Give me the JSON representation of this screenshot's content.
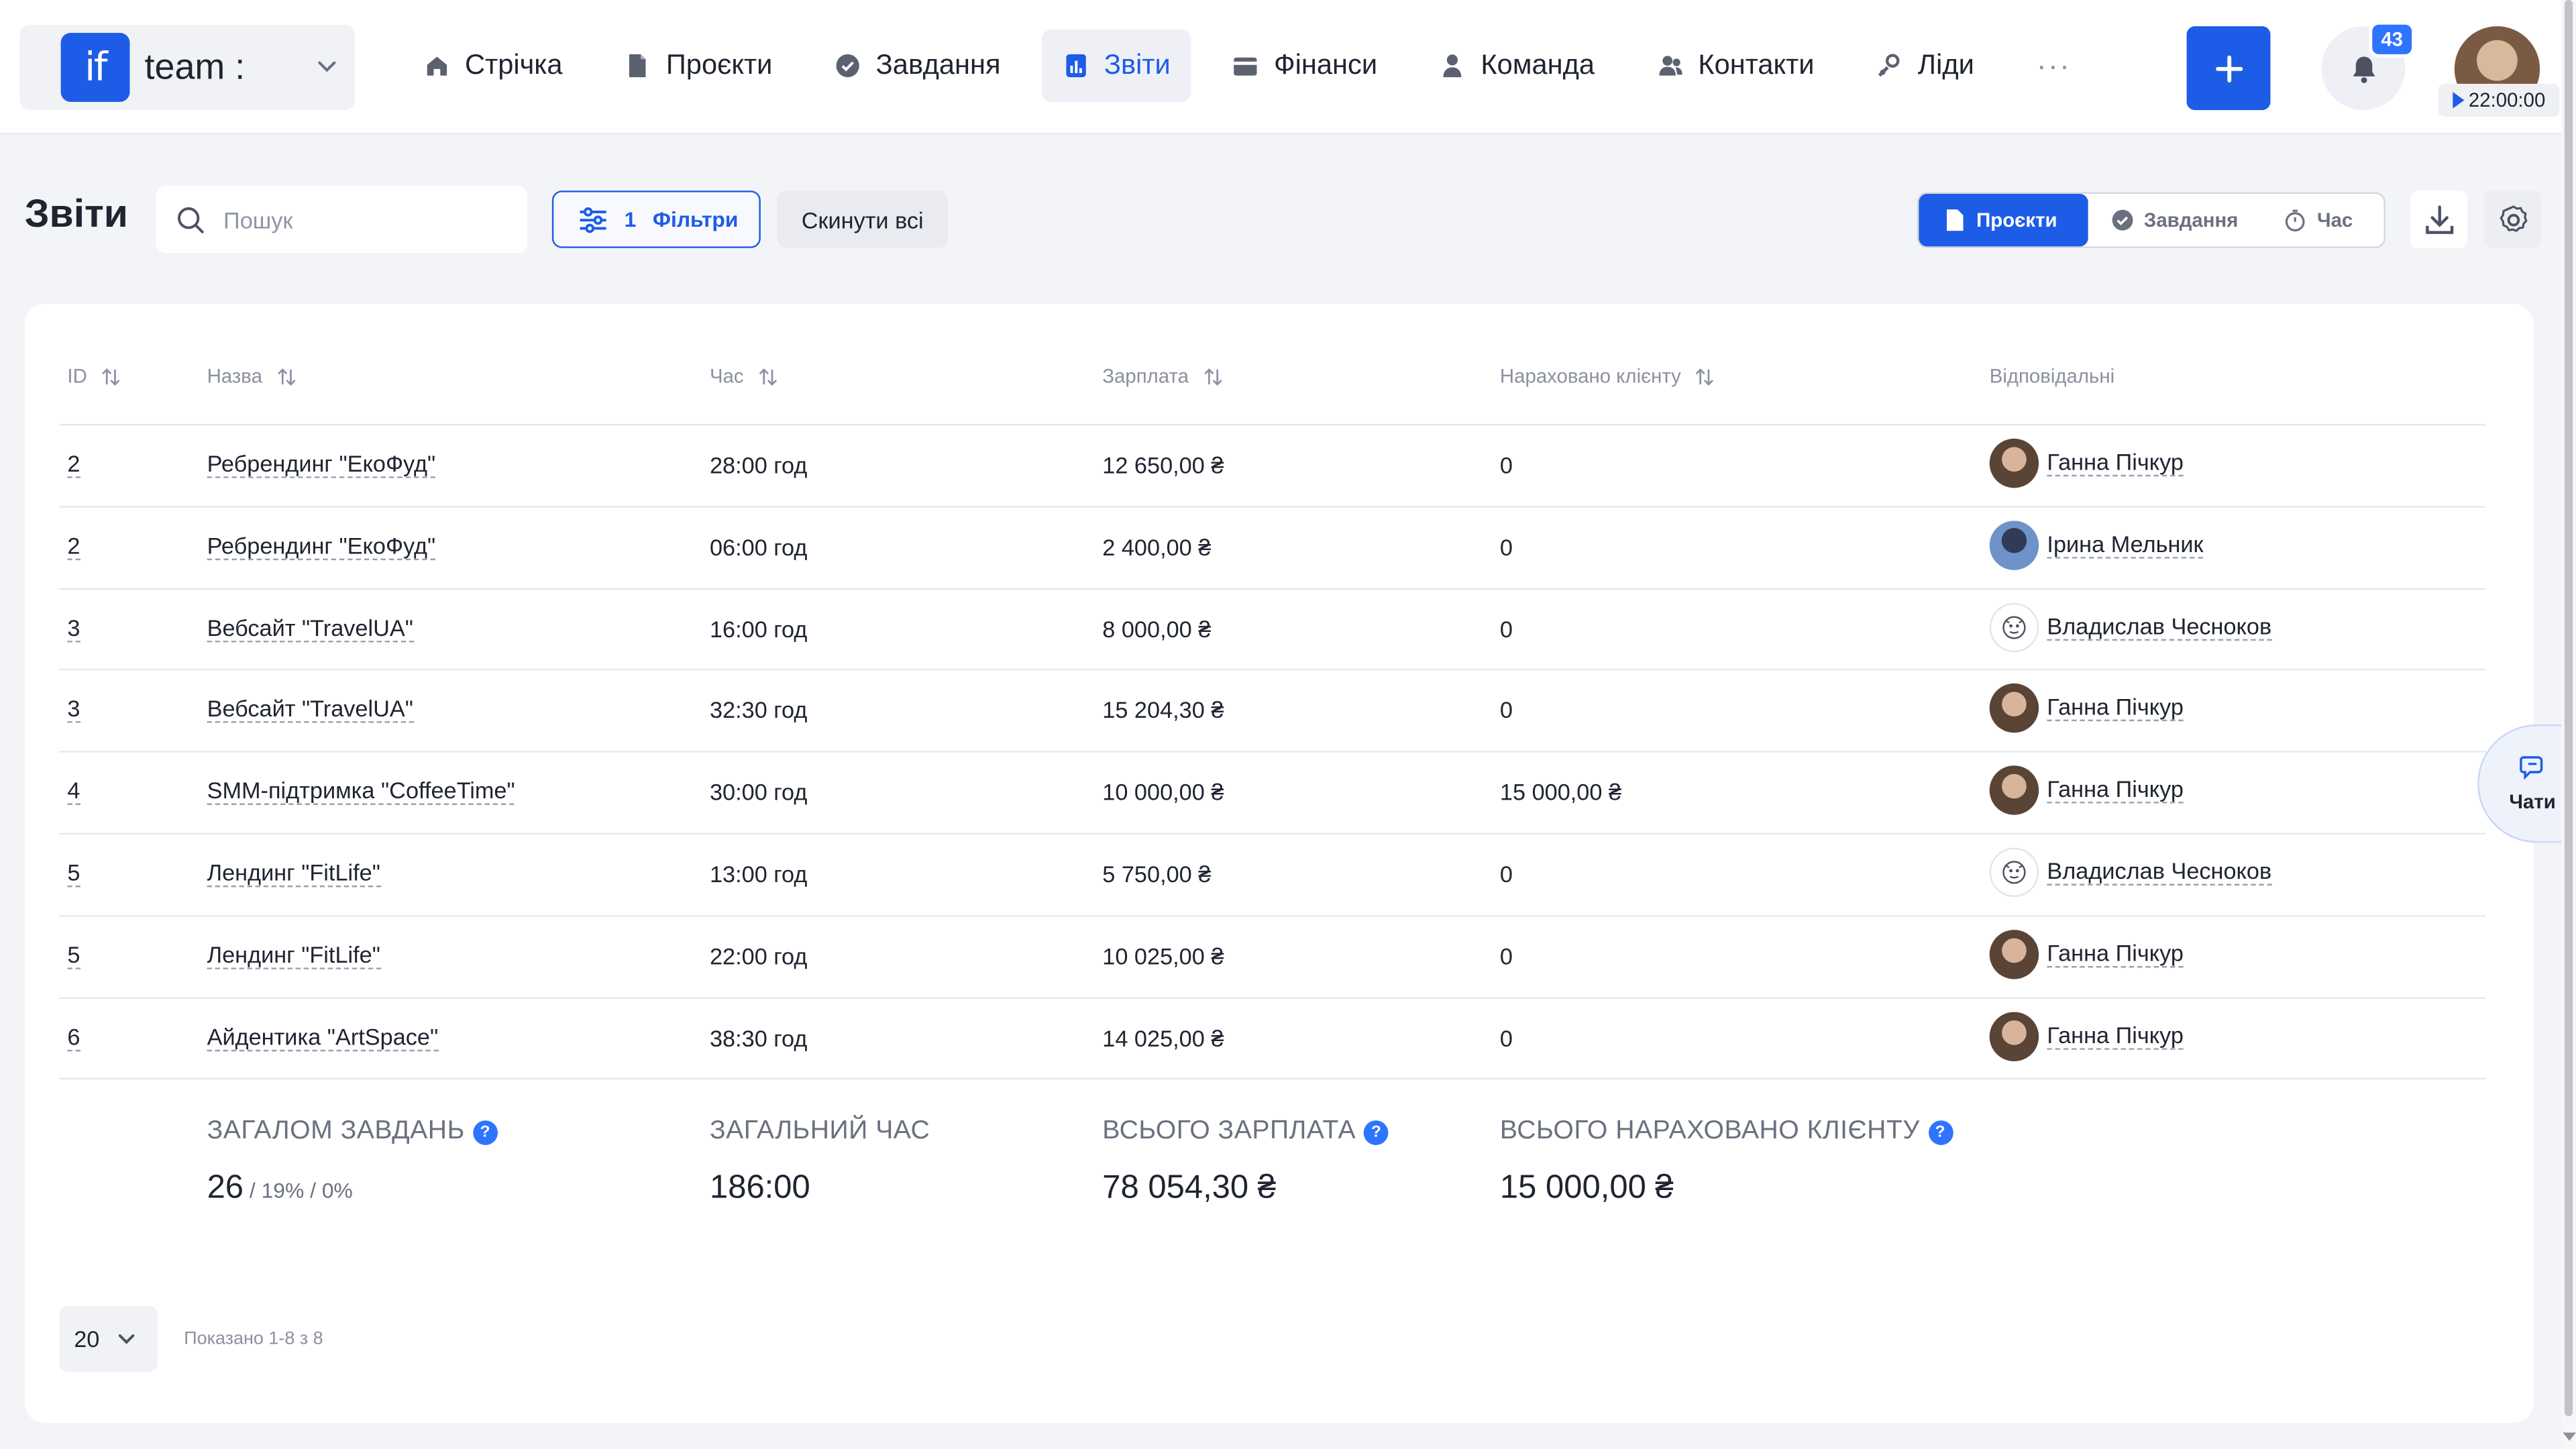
{
  "brand": {
    "logo_text": "if",
    "name": "team :"
  },
  "nav": {
    "items": [
      {
        "label": "Стрічка",
        "icon": "home-icon"
      },
      {
        "label": "Проєкти",
        "icon": "document-icon"
      },
      {
        "label": "Завдання",
        "icon": "check-circle-icon"
      },
      {
        "label": "Звіти",
        "icon": "chart-icon",
        "active": true
      },
      {
        "label": "Фінанси",
        "icon": "wallet-icon"
      },
      {
        "label": "Команда",
        "icon": "person-icon"
      },
      {
        "label": "Контакти",
        "icon": "contacts-icon"
      },
      {
        "label": "Ліди",
        "icon": "leads-icon"
      }
    ],
    "more": "···"
  },
  "header": {
    "notifications_count": "43",
    "timer": "22:00:00"
  },
  "toolbar": {
    "title": "Звіти",
    "search_placeholder": "Пошук",
    "filters_count": "1",
    "filters_label": "Фільтри",
    "reset_label": "Скинути всі",
    "view_tabs": [
      {
        "label": "Проєкти",
        "icon": "document-icon",
        "active": true
      },
      {
        "label": "Завдання",
        "icon": "check-circle-icon",
        "active": false
      },
      {
        "label": "Час",
        "icon": "stopwatch-icon",
        "active": false
      }
    ]
  },
  "table": {
    "columns": {
      "id": "ID",
      "name": "Назва",
      "time": "Час",
      "salary": "Зарплата",
      "charged": "Нараховано клієнту",
      "responsible": "Відповідальні"
    },
    "rows": [
      {
        "id": "2",
        "name": "Ребрендинг \"ЕкоФуд\"",
        "time": "28:00 год",
        "salary": "12 650,00 ₴",
        "charged": "0",
        "responsible": "Ганна Пічкур",
        "avatar": "hanna"
      },
      {
        "id": "2",
        "name": "Ребрендинг \"ЕкоФуд\"",
        "time": "06:00 год",
        "salary": "2 400,00 ₴",
        "charged": "0",
        "responsible": "Ірина Мельник",
        "avatar": "iryna"
      },
      {
        "id": "3",
        "name": "Вебсайт \"TravelUA\"",
        "time": "16:00 год",
        "salary": "8 000,00 ₴",
        "charged": "0",
        "responsible": "Владислав Чесноков",
        "avatar": "vlad"
      },
      {
        "id": "3",
        "name": "Вебсайт \"TravelUA\"",
        "time": "32:30 год",
        "salary": "15 204,30 ₴",
        "charged": "0",
        "responsible": "Ганна Пічкур",
        "avatar": "hanna"
      },
      {
        "id": "4",
        "name": "SMM-підтримка \"CoffeeTime\"",
        "time": "30:00 год",
        "salary": "10 000,00 ₴",
        "charged": "15 000,00 ₴",
        "responsible": "Ганна Пічкур",
        "avatar": "hanna"
      },
      {
        "id": "5",
        "name": "Лендинг \"FitLife\"",
        "time": "13:00 год",
        "salary": "5 750,00 ₴",
        "charged": "0",
        "responsible": "Владислав Чесноков",
        "avatar": "vlad"
      },
      {
        "id": "5",
        "name": "Лендинг \"FitLife\"",
        "time": "22:00 год",
        "salary": "10 025,00 ₴",
        "charged": "0",
        "responsible": "Ганна Пічкур",
        "avatar": "hanna"
      },
      {
        "id": "6",
        "name": "Айдентика \"ArtSpace\"",
        "time": "38:30 год",
        "salary": "14 025,00 ₴",
        "charged": "0",
        "responsible": "Ганна Пічкур",
        "avatar": "hanna"
      }
    ]
  },
  "totals": {
    "tasks_label": "ЗАГАЛОМ ЗАВДАНЬ",
    "tasks_value": "26",
    "tasks_sub": " / 19% / 0%",
    "time_label": "ЗАГАЛЬНИЙ ЧАС",
    "time_value": "186:00",
    "salary_label": "ВСЬОГО ЗАРПЛАТА",
    "salary_value": "78 054,30 ₴",
    "charged_label": "ВСЬОГО НАРАХОВАНО КЛІЄНТУ",
    "charged_value": "15 000,00 ₴"
  },
  "pagination": {
    "page_size": "20",
    "info": "Показано 1-8 з 8"
  },
  "chat": {
    "label": "Чати"
  },
  "colors": {
    "accent": "#1d5ce6",
    "badge": "#2e74ff",
    "background": "#f3f4f7"
  }
}
